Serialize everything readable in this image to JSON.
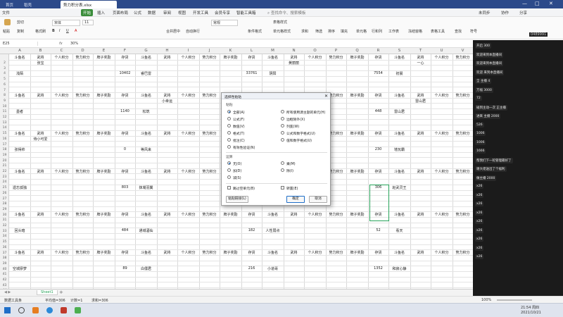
{
  "tabs": {
    "home": "首页",
    "store": "稻壳",
    "file": "势力积分表.xlsx"
  },
  "menu": [
    "文件",
    "开始",
    "插入",
    "页面布局",
    "公式",
    "数据",
    "审阅",
    "视图",
    "开发工具",
    "会员专享",
    "智能工具箱"
  ],
  "menu_active_index": 1,
  "menu_right": {
    "search": "查找命令、搜索模板",
    "unsync": "未同步",
    "collab": "协作",
    "share": "分享"
  },
  "ribbon": {
    "paste": "粘贴",
    "cut": "剪切",
    "copy": "复制",
    "format_painter": "格式刷",
    "font_name": "宋体",
    "font_size": "11",
    "merge": "合并居中",
    "wrap": "自动换行",
    "number_format": "常规",
    "cond_format": "条件格式",
    "table_style": "表格样式",
    "cell_style": "单元格样式",
    "sum": "求和",
    "filter": "筛选",
    "sort": "排序",
    "fill": "填充",
    "single": "单元格",
    "row_col": "行和列",
    "worksheet": "工作表",
    "freeze": "冻结窗格",
    "table_tools": "表格工具",
    "find": "查找",
    "symbol": "符号"
  },
  "formula": {
    "cell_ref": "E25",
    "fx": "fx",
    "value": "30%"
  },
  "columns": [
    "A",
    "B",
    "C",
    "D",
    "E",
    "F",
    "G",
    "H",
    "I",
    "J",
    "K",
    "L",
    "M",
    "N",
    "O",
    "P",
    "Q",
    "R",
    "S",
    "T",
    "U",
    "V",
    "W"
  ],
  "header_labels": {
    "name": "斗鱼名",
    "general": "武将",
    "personal": "个人积分",
    "power": "势力积分",
    "badge": "牌子奖励",
    "stock": "存货"
  },
  "rows_left": [
    "2",
    "3",
    "4",
    "5",
    "6",
    "7",
    "8",
    "9",
    "10",
    "11",
    "12",
    "13",
    "14",
    "15",
    "16",
    "17",
    "18",
    "19",
    "20",
    "21",
    "22",
    "23",
    "24",
    "25",
    "26",
    "27",
    "28",
    "29",
    "30",
    "31",
    "32",
    "33",
    "34",
    "35",
    "36",
    "37",
    "38",
    "39",
    "40",
    "41",
    "42",
    "43",
    "44"
  ],
  "names_col1": [
    "浅陌",
    "墨者",
    "张得帅",
    "遗忘孤独",
    "回头暗",
    "空城廖梦"
  ],
  "generals_col1": [
    "张宝",
    "",
    "侍小可爱",
    "",
    "",
    ""
  ],
  "stock_col1": [
    "10402",
    "1140",
    "0",
    "803",
    "484",
    "89"
  ],
  "names_col2": [
    "睿巴雷",
    "松筑",
    "等风来",
    "抹凝羽翼",
    "通城酒仙",
    "白僵君"
  ],
  "generals_col2": [
    "",
    "小幸运",
    "",
    "",
    "",
    ""
  ],
  "stock_col2": [
    "33761",
    "",
    "",
    "",
    "182",
    "216"
  ],
  "names_col3": [
    "阴阳",
    "",
    "",
    "",
    "人性弱点",
    "小道哥"
  ],
  "generals_col3": [
    "黄丽丽",
    "",
    "",
    "",
    "",
    ""
  ],
  "stock_col3": [
    "7554",
    "448",
    "230",
    "306",
    "52",
    "1352"
  ],
  "names_col4": [
    "初晨",
    "雷山君",
    "墙瓦霸",
    "赵武灵王",
    "看天",
    "和寂心静"
  ],
  "generals_col4": [
    "一心",
    "雷山君",
    "",
    "",
    "",
    ""
  ],
  "dialog": {
    "title": "选择性粘贴",
    "paste_section": "粘贴",
    "paste_left": [
      "全部(A)",
      "公式(F)",
      "数值(V)",
      "格式(T)",
      "批注(C)",
      "有效性验证(N)"
    ],
    "paste_right": [
      "所有使用源主题的单元(H)",
      "边框除外(X)",
      "列宽(W)",
      "公式和数字格式(U)",
      "值和数字格式(U)"
    ],
    "op_section": "运算",
    "op_left": [
      "无(O)",
      "加(D)",
      "减(S)"
    ],
    "op_right": [
      "乘(M)",
      "除(I)"
    ],
    "skip_blanks": "跳过空单元(B)",
    "transpose": "转置(E)",
    "paste_link": "粘贴链接(L)",
    "ok": "确定",
    "cancel": "取消"
  },
  "sheet_tab": "Sheet1",
  "status": {
    "left": "数据工具条",
    "avg": "平均值=306",
    "count": "计数=1",
    "sum": "求和=306",
    "zoom": "100%"
  },
  "taskbar": {
    "time": "21:54",
    "day": "周四",
    "date": "2021/10/21"
  },
  "side": {
    "view_count": "0489991",
    "chat": [
      "开启 300",
      "欢迎来到本直播间",
      "欢迎来到本直播间",
      "欢迎 来到本直播间",
      "全 主播 4",
      "万福 3000",
      "72",
      "碰到主动一次 正主播",
      "进来 主播 2000",
      "526",
      "1006",
      "1006",
      "1666",
      "帮我们下一轮管理最好了",
      "谢大佬送出了个福利",
      "做主播 2000",
      "x26",
      "x26",
      "x26",
      "x26",
      "x26",
      "x26",
      "x26",
      "x26",
      "x26"
    ]
  },
  "colors": {
    "title_bar": "#2c4a8a",
    "accent": "#3b8d3b",
    "selection": "#27a35a",
    "side_bg": "#1b1b1b",
    "dialog_primary": "#1e6ec8"
  }
}
